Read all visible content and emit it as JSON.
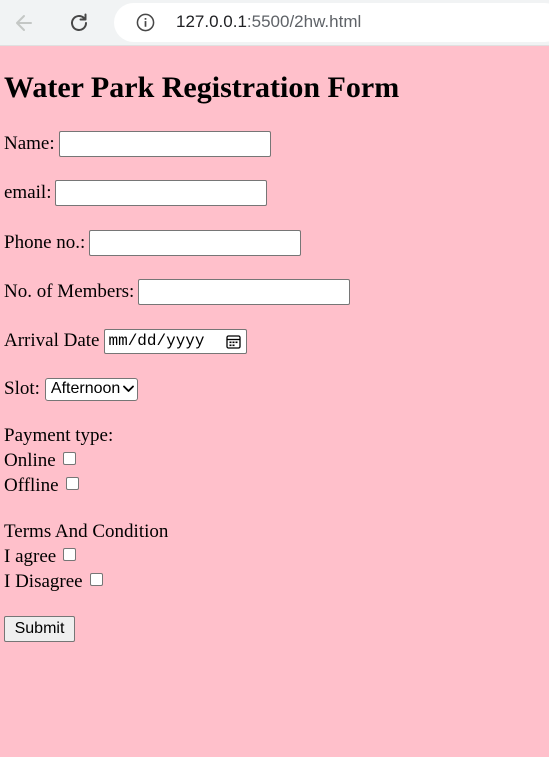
{
  "browser": {
    "url_host": "127.0.0.1",
    "url_path": ":5500/2hw.html",
    "back_icon": "arrow-left-icon",
    "reload_icon": "reload-icon",
    "info_icon": "info-icon"
  },
  "form": {
    "title": "Water Park Registration Form",
    "name_label": "Name:",
    "name_value": "",
    "email_label": "email:",
    "email_value": "",
    "phone_label": "Phone no.:",
    "phone_value": "",
    "members_label": "No. of Members:",
    "members_value": "",
    "arrival_label": "Arrival Date",
    "arrival_placeholder": "mm/dd/yyyy",
    "slot_label": "Slot:",
    "slot_selected": "Afternoon",
    "payment_label": "Payment type:",
    "payment_options": [
      {
        "label": "Online",
        "checked": false
      },
      {
        "label": "Offline",
        "checked": false
      }
    ],
    "terms_label": "Terms And Condition",
    "terms_options": [
      {
        "label": "I agree",
        "checked": false
      },
      {
        "label": "I Disagree",
        "checked": false
      }
    ],
    "submit_label": "Submit"
  },
  "colors": {
    "page_background": "#ffc0cb",
    "browser_bar": "#f1f3f4"
  }
}
